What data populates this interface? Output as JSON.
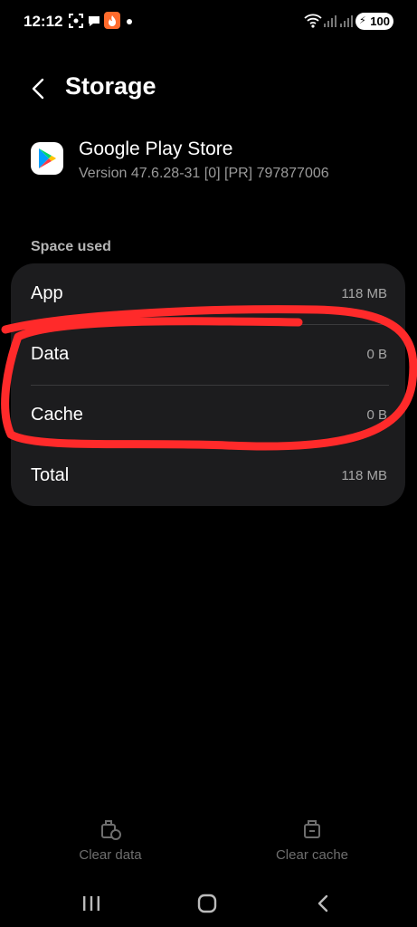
{
  "status_bar": {
    "time": "12:12",
    "battery": "100",
    "icons": [
      "screenshot-icon",
      "chat-icon",
      "app-notification-icon",
      "dot-icon",
      "wifi-icon",
      "signal-icon",
      "signal-icon-2"
    ]
  },
  "header": {
    "title": "Storage",
    "back_icon": "back-arrow-icon"
  },
  "app": {
    "name": "Google Play Store",
    "version": "Version 47.6.28-31 [0] [PR] 797877006",
    "icon": "google-play-icon"
  },
  "space_used": {
    "label": "Space used",
    "rows": [
      {
        "label": "App",
        "value": "118 MB"
      },
      {
        "label": "Data",
        "value": "0 B"
      },
      {
        "label": "Cache",
        "value": "0 B"
      },
      {
        "label": "Total",
        "value": "118 MB"
      }
    ]
  },
  "actions": {
    "clear_data": "Clear data",
    "clear_cache": "Clear cache"
  },
  "navbar": {
    "icons": [
      "recents-icon",
      "home-icon",
      "back-icon"
    ]
  },
  "colors": {
    "background": "#000000",
    "card": "#1c1c1e",
    "annotation": "#ff2a2a",
    "disabled_text": "#6e6e6e"
  }
}
